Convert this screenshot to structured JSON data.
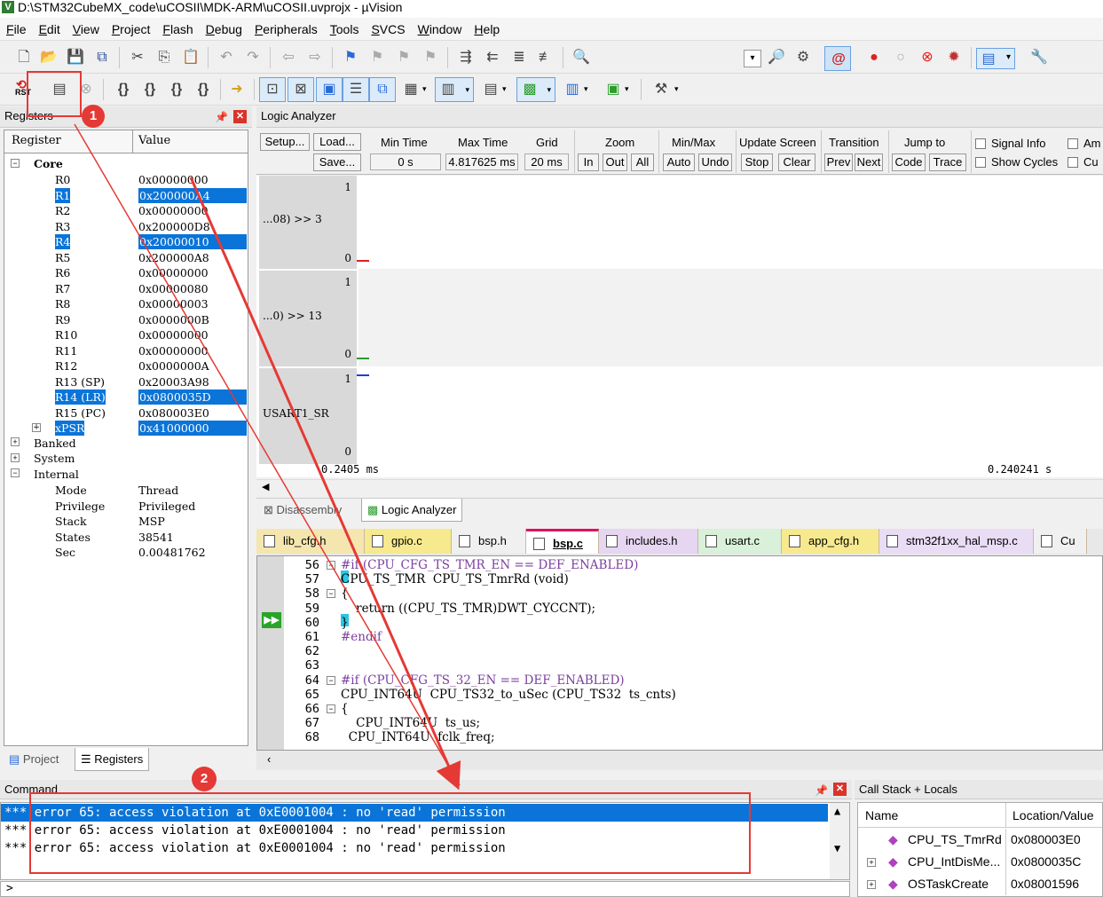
{
  "window": {
    "title": "D:\\STM32CubeMX_code\\uCOSII\\MDK-ARM\\uCOSII.uvprojx - µVision",
    "app_icon": "V"
  },
  "menu": [
    "File",
    "Edit",
    "View",
    "Project",
    "Flash",
    "Debug",
    "Peripherals",
    "Tools",
    "SVCS",
    "Window",
    "Help"
  ],
  "toolbar2_first_label": "RST",
  "registers_panel": {
    "title": "Registers",
    "col_register": "Register",
    "col_value": "Value",
    "group_core": "Core",
    "rows": [
      {
        "name": "R0",
        "value": "0x00000000",
        "selected": false
      },
      {
        "name": "R1",
        "value": "0x200000A4",
        "selected": true
      },
      {
        "name": "R2",
        "value": "0x00000000",
        "selected": false
      },
      {
        "name": "R3",
        "value": "0x200000D8",
        "selected": false
      },
      {
        "name": "R4",
        "value": "0x20000010",
        "selected": true
      },
      {
        "name": "R5",
        "value": "0x200000A8",
        "selected": false
      },
      {
        "name": "R6",
        "value": "0x00000000",
        "selected": false
      },
      {
        "name": "R7",
        "value": "0x00000080",
        "selected": false
      },
      {
        "name": "R8",
        "value": "0x00000003",
        "selected": false
      },
      {
        "name": "R9",
        "value": "0x0000000B",
        "selected": false
      },
      {
        "name": "R10",
        "value": "0x00000000",
        "selected": false
      },
      {
        "name": "R11",
        "value": "0x00000000",
        "selected": false
      },
      {
        "name": "R12",
        "value": "0x0000000A",
        "selected": false
      },
      {
        "name": "R13 (SP)",
        "value": "0x20003A98",
        "selected": false
      },
      {
        "name": "R14 (LR)",
        "value": "0x0800035D",
        "selected": true
      },
      {
        "name": "R15 (PC)",
        "value": "0x080003E0",
        "selected": false
      },
      {
        "name": "xPSR",
        "value": "0x41000000",
        "selected": true
      }
    ],
    "group_banked": "Banked",
    "group_system": "System",
    "group_internal": "Internal",
    "internal": [
      {
        "name": "Mode",
        "value": "Thread"
      },
      {
        "name": "Privilege",
        "value": "Privileged"
      },
      {
        "name": "Stack",
        "value": "MSP"
      },
      {
        "name": "States",
        "value": "38541"
      },
      {
        "name": "Sec",
        "value": "0.00481762"
      }
    ],
    "tab_project": "Project",
    "tab_registers": "Registers"
  },
  "logic_analyzer": {
    "title": "Logic Analyzer",
    "setup": "Setup...",
    "load": "Load...",
    "save": "Save...",
    "min_time_label": "Min Time",
    "min_time": "0 s",
    "max_time_label": "Max Time",
    "max_time": "4.817625 ms",
    "grid_label": "Grid",
    "grid": "20 ms",
    "zoom_label": "Zoom",
    "zoom_in": "In",
    "zoom_out": "Out",
    "zoom_all": "All",
    "minmax_label": "Min/Max",
    "auto": "Auto",
    "undo": "Undo",
    "update_label": "Update Screen",
    "stop": "Stop",
    "clear": "Clear",
    "transition_label": "Transition",
    "prev": "Prev",
    "next": "Next",
    "jump_label": "Jump to",
    "code": "Code",
    "trace": "Trace",
    "signal_info": "Signal Info",
    "show_cycles": "Show Cycles",
    "am": "Am",
    "cu": "Cu",
    "signals": [
      {
        "name": "...08) >> 3",
        "hi": "1",
        "lo": "0"
      },
      {
        "name": "...0) >> 13",
        "hi": "1",
        "lo": "0"
      },
      {
        "name": "USART1_SR",
        "hi": "1",
        "lo": "0"
      }
    ],
    "axis_left": "0.2405 ms",
    "axis_right": "0.240241 s",
    "colors": {
      "sig1": "#e02020",
      "sig2": "#2a9d2a",
      "sig3": "#1f3fd0"
    }
  },
  "mid_tabs": {
    "disassembly": "Disassembly",
    "logic": "Logic Analyzer"
  },
  "editor": {
    "tabs": [
      {
        "label": "lib_cfg.h",
        "color": "#f5e6b0",
        "active": false
      },
      {
        "label": "gpio.c",
        "color": "#f7e98e",
        "active": false
      },
      {
        "label": "bsp.h",
        "color": "#f0f0f0",
        "active": false
      },
      {
        "label": "bsp.c",
        "color": "#ffffff",
        "active": true
      },
      {
        "label": "includes.h",
        "color": "#e6d6f2",
        "active": false
      },
      {
        "label": "usart.c",
        "color": "#d9f0d9",
        "active": false
      },
      {
        "label": "app_cfg.h",
        "color": "#f7e98e",
        "active": false
      },
      {
        "label": "stm32f1xx_hal_msp.c",
        "color": "#e9dcf5",
        "active": false
      },
      {
        "label": "Cu",
        "color": "#f0f0f0",
        "active": false
      }
    ],
    "lines": [
      {
        "n": "56",
        "t": "#if (CPU_CFG_TS_TMR_EN == DEF_ENABLED)"
      },
      {
        "n": "57",
        "t": "CPU_TS_TMR  CPU_TS_TmrRd (void)"
      },
      {
        "n": "58",
        "t": "{"
      },
      {
        "n": "59",
        "t": "    return ((CPU_TS_TMR)DWT_CYCCNT);"
      },
      {
        "n": "60",
        "t": "}"
      },
      {
        "n": "61",
        "t": "#endif"
      },
      {
        "n": "62",
        "t": ""
      },
      {
        "n": "63",
        "t": ""
      },
      {
        "n": "64",
        "t": "#if (CPU_CFG_TS_32_EN == DEF_ENABLED)"
      },
      {
        "n": "65",
        "t": "CPU_INT64U  CPU_TS32_to_uSec (CPU_TS32  ts_cnts)"
      },
      {
        "n": "66",
        "t": "{"
      },
      {
        "n": "67",
        "t": "    CPU_INT64U  ts_us;"
      },
      {
        "n": "68",
        "t": "  CPU_INT64U  fclk_freq;"
      }
    ]
  },
  "command": {
    "title": "Command",
    "lines": [
      "*** error 65: access violation at 0xE0001004 : no 'read' permission",
      "*** error 65: access violation at 0xE0001004 : no 'read' permission",
      "*** error 65: access violation at 0xE0001004 : no 'read' permission"
    ],
    "prompt": ">"
  },
  "callstack": {
    "title": "Call Stack + Locals",
    "col_name": "Name",
    "col_loc": "Location/Value",
    "rows": [
      {
        "name": "CPU_TS_TmrRd",
        "loc": "0x080003E0"
      },
      {
        "name": "CPU_IntDisMe...",
        "loc": "0x0800035C"
      },
      {
        "name": "OSTaskCreate",
        "loc": "0x08001596"
      }
    ]
  },
  "annotations": {
    "badge1": "1",
    "badge2": "2",
    "color": "#e53935"
  }
}
